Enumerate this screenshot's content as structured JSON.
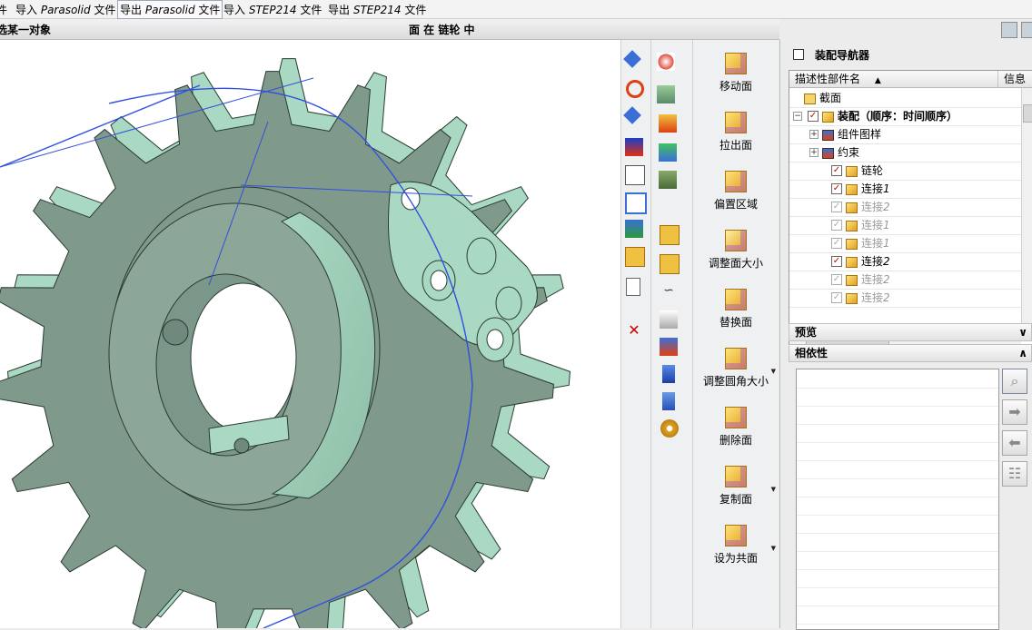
{
  "menu": {
    "items": [
      {
        "prefix": "件",
        "name": "",
        "suffix": ""
      },
      {
        "prefix": "导入 ",
        "name": "Parasolid",
        "suffix": " 文件"
      },
      {
        "prefix": "导出 ",
        "name": "Parasolid",
        "suffix": " 文件"
      },
      {
        "prefix": "导入 ",
        "name": "STEP214",
        "suffix": " 文件"
      },
      {
        "prefix": "导出 ",
        "name": "STEP214",
        "suffix": " 文件"
      }
    ]
  },
  "status": {
    "selection_filter": "选某一对象",
    "hover_info": "面 在 链轮 中"
  },
  "feature_buttons": [
    {
      "label": "移动面",
      "icon": "move-face-icon",
      "dropdown": false
    },
    {
      "label": "拉出面",
      "icon": "pull-face-icon",
      "dropdown": false
    },
    {
      "label": "偏置区域",
      "icon": "offset-region-icon",
      "dropdown": false
    },
    {
      "label": "调整面大小",
      "icon": "resize-face-icon",
      "dropdown": false
    },
    {
      "label": "替换面",
      "icon": "replace-face-icon",
      "dropdown": false
    },
    {
      "label": "调整圆角大小",
      "icon": "resize-blend-icon",
      "dropdown": true
    },
    {
      "label": "删除面",
      "icon": "delete-face-icon",
      "dropdown": false
    },
    {
      "label": "复制面",
      "icon": "copy-face-icon",
      "dropdown": true
    },
    {
      "label": "设为共面",
      "icon": "make-coplanar-icon",
      "dropdown": true
    }
  ],
  "navigator": {
    "title": "装配导航器",
    "columns": {
      "name": "描述性部件名",
      "info": "信息"
    },
    "rows": [
      {
        "label": "截面",
        "indent": 1,
        "kind": "folder",
        "check": "none",
        "dim": false,
        "italic_suffix": ""
      },
      {
        "label": "装配（顺序：时间顺序）",
        "indent": 0,
        "kind": "assembly",
        "check": "checked",
        "dim": false,
        "italic_suffix": "",
        "expander": "⊟",
        "bold": true
      },
      {
        "label": "组件图样",
        "indent": 1,
        "kind": "pattern",
        "check": "none",
        "dim": false,
        "italic_suffix": "",
        "expander": "⊞"
      },
      {
        "label": "约束",
        "indent": 1,
        "kind": "constraint",
        "check": "none",
        "dim": false,
        "italic_suffix": "",
        "expander": "⊞"
      },
      {
        "label": "链轮",
        "indent": 2,
        "kind": "part",
        "check": "checked",
        "dim": false,
        "italic_suffix": ""
      },
      {
        "label": "连接",
        "indent": 2,
        "kind": "part",
        "check": "checked",
        "dim": false,
        "italic_suffix": "1"
      },
      {
        "label": "连接",
        "indent": 2,
        "kind": "part",
        "check": "dim",
        "dim": true,
        "italic_suffix": "2"
      },
      {
        "label": "连接",
        "indent": 2,
        "kind": "part",
        "check": "dim",
        "dim": true,
        "italic_suffix": "1"
      },
      {
        "label": "连接",
        "indent": 2,
        "kind": "part",
        "check": "dim",
        "dim": true,
        "italic_suffix": "1"
      },
      {
        "label": "连接",
        "indent": 2,
        "kind": "part",
        "check": "checked",
        "dim": false,
        "italic_suffix": "2"
      },
      {
        "label": "连接",
        "indent": 2,
        "kind": "part",
        "check": "dim",
        "dim": true,
        "italic_suffix": "2"
      },
      {
        "label": "连接",
        "indent": 2,
        "kind": "part",
        "check": "dim",
        "dim": true,
        "italic_suffix": "2"
      }
    ]
  },
  "panels": {
    "preview": "预览",
    "dependencies": "相依性"
  },
  "colors": {
    "part_face": "#7f9a8a",
    "part_face_light": "#a9d9c2",
    "part_edge": "#2a3a33",
    "pitch_curve": "#2f4fe0"
  }
}
